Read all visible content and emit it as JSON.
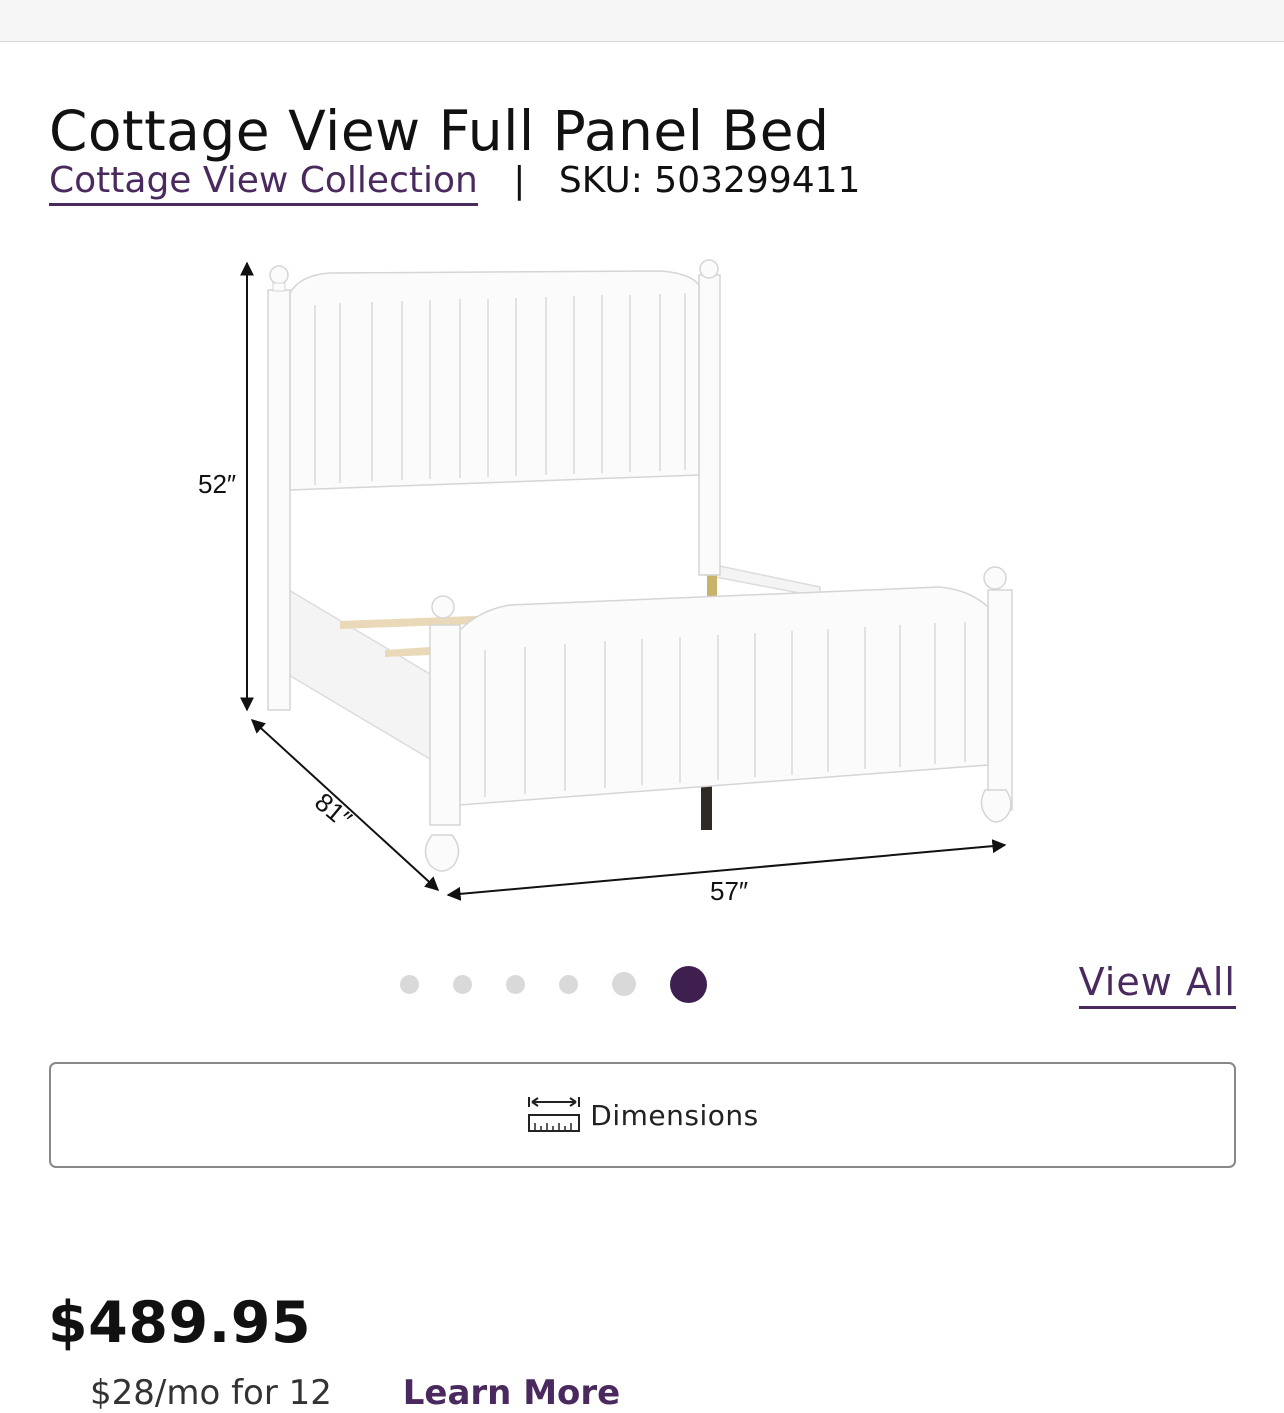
{
  "product": {
    "title": "Cottage View Full Panel Bed",
    "collection_link": "Cottage View Collection",
    "separator": "|",
    "sku": "SKU: 503299411"
  },
  "image": {
    "dimensions": {
      "height": "52″",
      "depth": "81″",
      "width": "57″"
    }
  },
  "carousel": {
    "slide_count": 6,
    "active_index": 6,
    "view_all_label": "View All"
  },
  "dimensions_button": {
    "label": "Dimensions",
    "icon": "ruler-icon"
  },
  "pricing": {
    "price": "$489.95",
    "finance_partial": "$28/mo for 12",
    "finance_link_partial": "Learn More"
  },
  "colors": {
    "accent": "#4a2a5e",
    "active_dot": "#3f1f4f",
    "inactive_dot": "#d9d9d9"
  }
}
